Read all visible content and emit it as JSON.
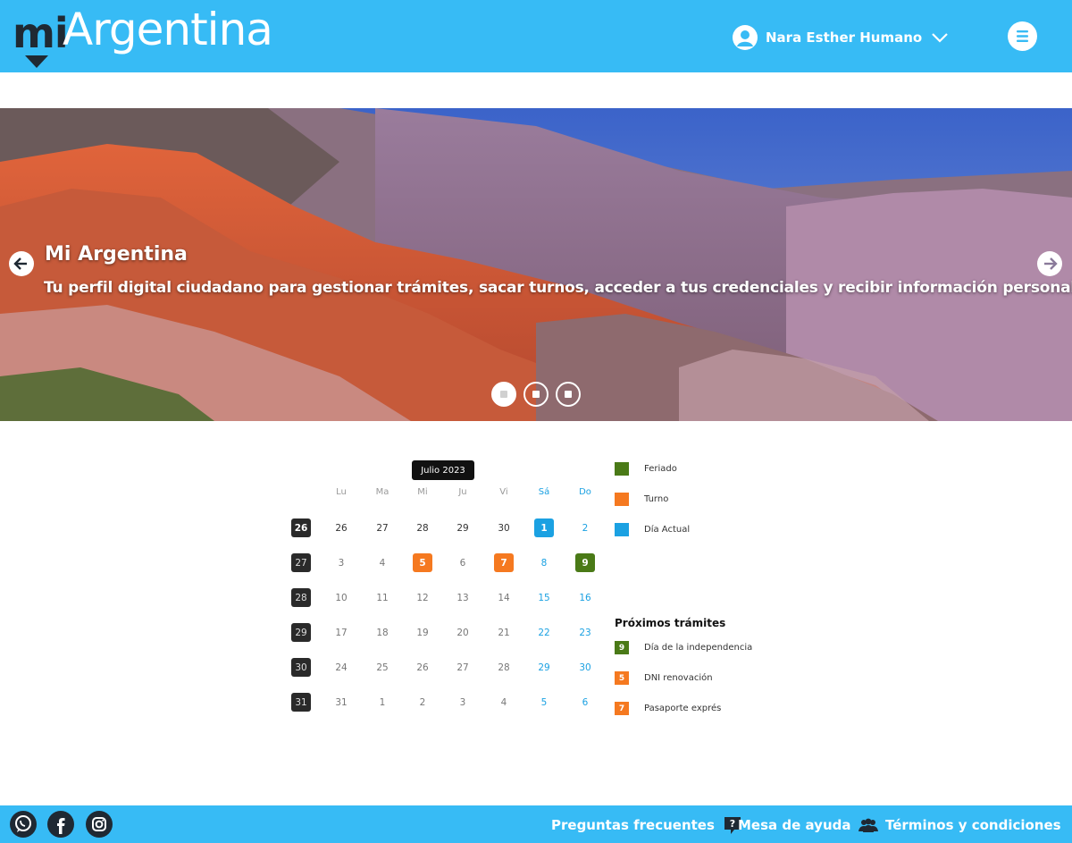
{
  "header": {
    "logo_mi": "mi",
    "logo_argentina": "Argentina",
    "user_name": "Nara Esther Humano"
  },
  "hero": {
    "title": "Mi Argentina",
    "subtitle": "Tu perfil digital ciudadano para gestionar trámites, sacar turnos, acceder a tus credenciales y recibir información personalizada.",
    "slides": 3,
    "active_slide": 1
  },
  "calendar": {
    "month_label": "Julio 2023",
    "days_of_week": [
      "Lu",
      "Ma",
      "Mi",
      "Ju",
      "Vi",
      "Sá",
      "Do"
    ],
    "weeks": [
      {
        "week": "26",
        "days": [
          "26",
          "27",
          "28",
          "29",
          "30",
          "1",
          "2"
        ]
      },
      {
        "week": "27",
        "days": [
          "3",
          "4",
          "5",
          "6",
          "7",
          "8",
          "9"
        ]
      },
      {
        "week": "28",
        "days": [
          "10",
          "11",
          "12",
          "13",
          "14",
          "15",
          "16"
        ]
      },
      {
        "week": "29",
        "days": [
          "17",
          "18",
          "19",
          "20",
          "21",
          "22",
          "23"
        ]
      },
      {
        "week": "30",
        "days": [
          "24",
          "25",
          "26",
          "27",
          "28",
          "29",
          "30"
        ]
      },
      {
        "week": "31",
        "days": [
          "31",
          "1",
          "2",
          "3",
          "4",
          "5",
          "6"
        ]
      }
    ],
    "highlights": {
      "actual": [
        "0-5"
      ],
      "turno": [
        "1-2",
        "1-4"
      ],
      "feriado": [
        "1-6"
      ]
    }
  },
  "legend": [
    {
      "label": "Feriado",
      "color": "#4a7a17"
    },
    {
      "label": "Turno",
      "color": "#f57920"
    },
    {
      "label": "Día Actual",
      "color": "#1ba1e2"
    }
  ],
  "proximos": {
    "title": "Próximos trámites",
    "items": [
      {
        "day": "9",
        "label": "Día de la independencia",
        "color": "#4a7a17"
      },
      {
        "day": "5",
        "label": "DNI renovación",
        "color": "#f57920"
      },
      {
        "day": "7",
        "label": "Pasaporte exprés",
        "color": "#f57920"
      }
    ]
  },
  "footer": {
    "faq": "Preguntas frecuentes",
    "help": "Mesa de ayuda",
    "terms": "Términos y condiciones",
    "social": [
      "whatsapp-icon",
      "facebook-icon",
      "instagram-icon"
    ]
  },
  "colors": {
    "brand": "#37bbf5",
    "dark": "#1f2933"
  }
}
